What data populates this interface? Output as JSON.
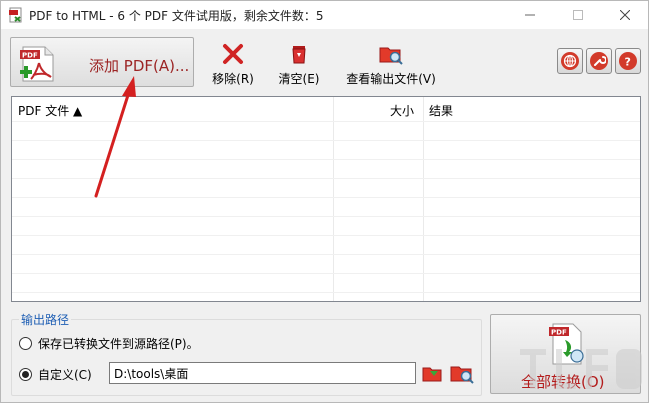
{
  "window": {
    "title": "PDF to HTML - 6 个 PDF 文件试用版，剩余文件数：5"
  },
  "toolbar": {
    "add_pdf_label": "添加 PDF(A)...",
    "remove_label": "移除(R)",
    "clear_label": "清空(E)",
    "view_output_label": "查看输出文件(V)"
  },
  "file_list": {
    "columns": [
      "PDF 文件 ▲",
      "大小",
      "结果"
    ],
    "rows": []
  },
  "output": {
    "group_title": "输出路径",
    "option_source_label": "保存已转换文件到源路径(P)。",
    "option_custom_label": "自定义(C)",
    "custom_path_value": "D:\\tools\\桌面",
    "selected_option": "custom"
  },
  "convert": {
    "convert_all_label": "全部转换(O)"
  },
  "colors": {
    "accent_red": "#9c2424",
    "group_title_blue": "#1f5fb4",
    "annotation_arrow": "#d42020"
  },
  "icons": {
    "pdf_add": "pdf-add-icon",
    "remove": "red-x-icon",
    "clear": "recycle-bin-icon",
    "view_output": "folder-search-icon",
    "web": "globe-icon",
    "settings": "wrench-icon",
    "help": "question-icon"
  }
}
